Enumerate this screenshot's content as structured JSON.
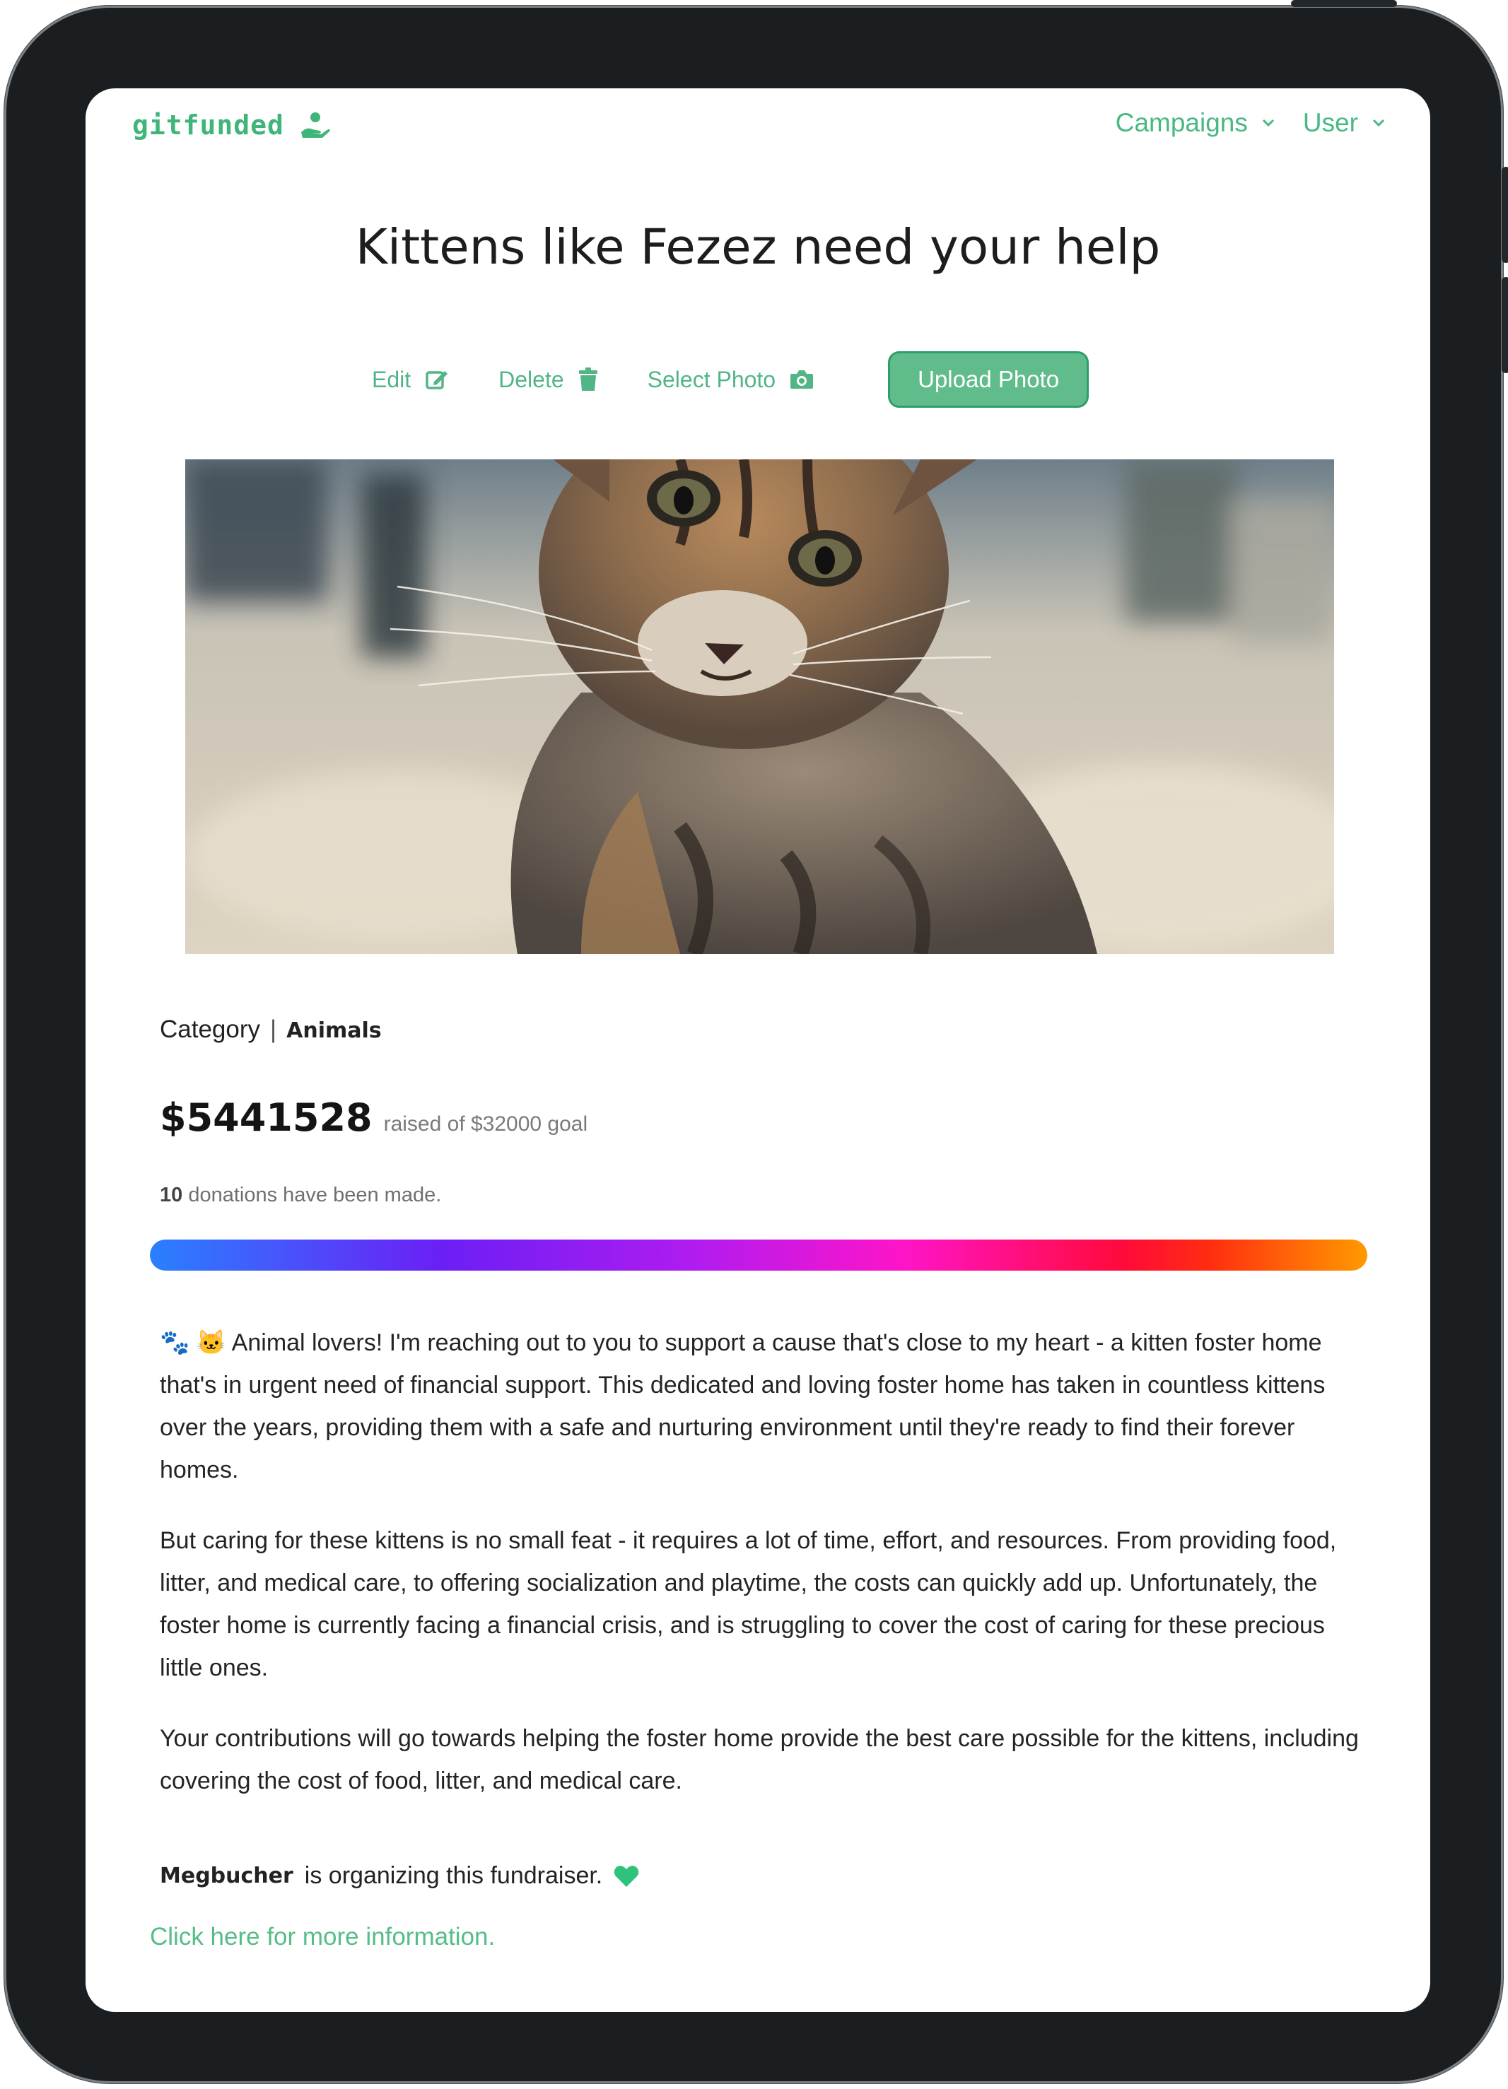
{
  "brand": {
    "name": "gitfunded",
    "accent": "#3fb57a"
  },
  "nav": {
    "items": [
      {
        "label": "Campaigns",
        "icon": "chevron-down-icon"
      },
      {
        "label": "User",
        "icon": "chevron-down-icon"
      }
    ]
  },
  "campaign": {
    "title": "Kittens like Fezez need your help",
    "actions": {
      "edit": "Edit",
      "delete": "Delete",
      "select_photo": "Select Photo",
      "upload_photo": "Upload Photo"
    },
    "photo_icon": "kitten-photo",
    "category_label": "Category",
    "category_value": "Animals",
    "amount_raised": "$5441528",
    "goal_text": "raised of $32000 goal",
    "donation_count": "10",
    "donation_text": "donations have been made.",
    "progress_fraction": 1.0,
    "description": [
      "🐾 🐱 Animal lovers! I'm reaching out to you to support a cause that's close to my heart - a kitten foster home that's in urgent need of financial support. This dedicated and loving foster home has taken in countless kittens over the years, providing them with a safe and nurturing environment until they're ready to find their forever homes.",
      "But caring for these kittens is no small feat - it requires a lot of time, effort, and resources. From providing food, litter, and medical care, to offering socialization and playtime, the costs can quickly add up. Unfortunately, the foster home is currently facing a financial crisis, and is struggling to cover the cost of caring for these precious little ones.",
      "Your contributions will go towards helping the foster home provide the best care possible for the kittens, including covering the cost of food, litter, and medical care."
    ],
    "organizer_name": "Megbucher",
    "organizer_text": "is organizing this fundraiser.",
    "more_info_link": "Click here for more information."
  }
}
